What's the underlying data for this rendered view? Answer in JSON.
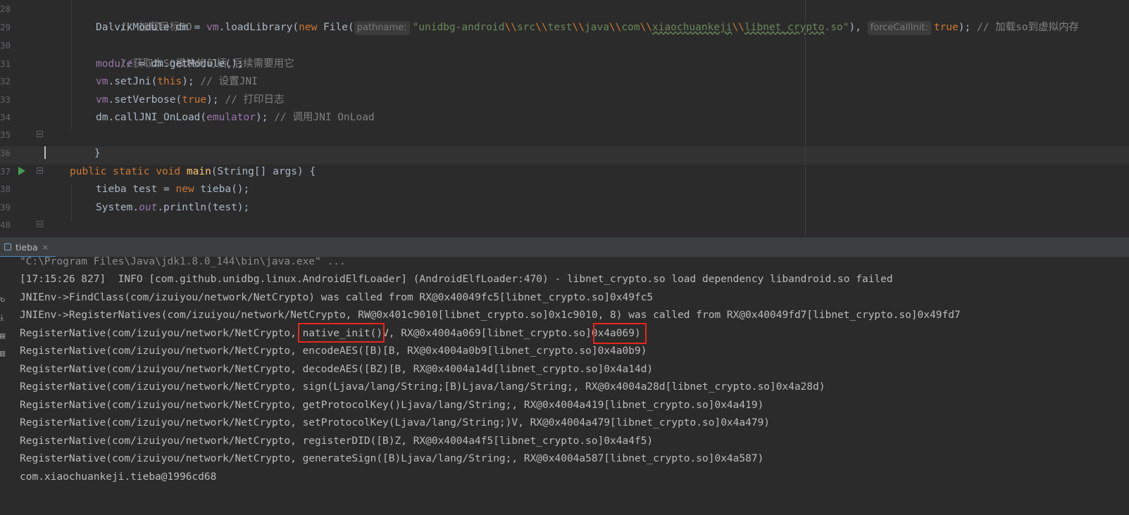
{
  "editor": {
    "line_numbers": [
      "28",
      "29",
      "30",
      "31",
      "32",
      "33",
      "34",
      "35",
      "36",
      "37",
      "38",
      "39",
      "40"
    ],
    "line28": {
      "comment": "// 加载目标SO"
    },
    "line29": {
      "a": "DalvikModule dm = ",
      "vm": "vm",
      "b": ".loadLibrary(",
      "new": "new",
      "c": " File(",
      "hint1": "pathname:",
      "str_q1": "\"",
      "s1": "unidbg-android",
      "esc1": "\\\\",
      "s2": "src",
      "esc2": "\\\\",
      "s3": "test",
      "esc3": "\\\\",
      "s4": "java",
      "esc4": "\\\\",
      "s5": "com",
      "esc5": "\\\\",
      "s6": "xiaochuankeji",
      "esc6": "\\\\",
      "s7": "libnet_crypto",
      "s8": ".so",
      "str_q2": "\"",
      "d": "),",
      "hint2": "forceCallInit:",
      "tru": "true",
      "e": ");",
      "comment": " // 加载so到虚拟内存"
    },
    "line30": {
      "comment": "//获取本SO模块的句柄,后续需要用它"
    },
    "line31": {
      "field": "module",
      "a": " = dm.getModule();"
    },
    "line32": {
      "vm": "vm",
      "a": ".setJni(",
      "kw": "this",
      "b": "); ",
      "comment": "// 设置JNI"
    },
    "line33": {
      "vm": "vm",
      "a": ".setVerbose(",
      "kw": "true",
      "b": "); ",
      "comment": "// 打印日志"
    },
    "line34": {
      "a": "dm.callJNI_OnLoad(",
      "field": "emulator",
      "b": "); ",
      "comment": "// 调用JNI OnLoad"
    },
    "line35": {
      "a": "}"
    },
    "line37": {
      "kw": "public static void ",
      "fn": "main",
      "a": "(String[] args) {"
    },
    "line38": {
      "a": "tieba test = ",
      "kw": "new",
      "b": " tieba();"
    },
    "line39": {
      "a": "System.",
      "field": "out",
      "b": ".println(test);"
    },
    "line40": {
      "a": "}"
    }
  },
  "run_panel": {
    "tab_label": "tieba",
    "tab_close": "×"
  },
  "console": {
    "lines": [
      "\"C:\\Program Files\\Java\\jdk1.8.0_144\\bin\\java.exe\" ...",
      "[17:15:26 827]  INFO [com.github.unidbg.linux.AndroidElfLoader] (AndroidElfLoader:470) - libnet_crypto.so load dependency libandroid.so failed",
      "JNIEnv->FindClass(com/izuiyou/network/NetCrypto) was called from RX@0x40049fc5[libnet_crypto.so]0x49fc5",
      "JNIEnv->RegisterNatives(com/izuiyou/network/NetCrypto, RW@0x401c9010[libnet_crypto.so]0x1c9010, 8) was called from RX@0x40049fd7[libnet_crypto.so]0x49fd7",
      "RegisterNative(com/izuiyou/network/NetCrypto, native_init()V, RX@0x4004a069[libnet_crypto.so]0x4a069)",
      "RegisterNative(com/izuiyou/network/NetCrypto, encodeAES([B)[B, RX@0x4004a0b9[libnet_crypto.so]0x4a0b9)",
      "RegisterNative(com/izuiyou/network/NetCrypto, decodeAES([BZ)[B, RX@0x4004a14d[libnet_crypto.so]0x4a14d)",
      "RegisterNative(com/izuiyou/network/NetCrypto, sign(Ljava/lang/String;[B)Ljava/lang/String;, RX@0x4004a28d[libnet_crypto.so]0x4a28d)",
      "RegisterNative(com/izuiyou/network/NetCrypto, getProtocolKey()Ljava/lang/String;, RX@0x4004a419[libnet_crypto.so]0x4a419)",
      "RegisterNative(com/izuiyou/network/NetCrypto, setProtocolKey(Ljava/lang/String;)V, RX@0x4004a479[libnet_crypto.so]0x4a479)",
      "RegisterNative(com/izuiyou/network/NetCrypto, registerDID([B)Z, RX@0x4004a4f5[libnet_crypto.so]0x4a4f5)",
      "RegisterNative(com/izuiyou/network/NetCrypto, generateSign([B)Ljava/lang/String;, RX@0x4004a587[libnet_crypto.so]0x4a587)",
      "com.xiaochuankeji.tieba@1996cd68"
    ]
  },
  "colors": {
    "background": "#2b2b2b",
    "keyword": "#cc7832",
    "string": "#6a8759",
    "comment": "#808080",
    "function": "#ffc66d",
    "field": "#9876aa",
    "highlight_box": "#e8261c"
  }
}
